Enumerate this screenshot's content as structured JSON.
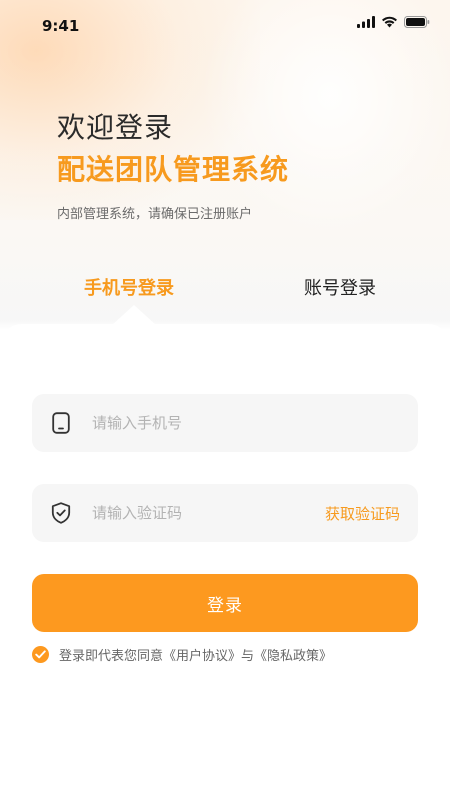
{
  "status_bar": {
    "time": "9:41",
    "icons": [
      "signal-icon",
      "wifi-icon",
      "battery-icon"
    ]
  },
  "header": {
    "welcome": "欢迎登录",
    "system_name": "配送团队管理系统",
    "subtitle": "内部管理系统，请确保已注册账户"
  },
  "tabs": [
    {
      "label": "手机号登录",
      "active": true
    },
    {
      "label": "账号登录",
      "active": false
    }
  ],
  "form": {
    "phone_placeholder": "请输入手机号",
    "phone_value": "",
    "code_placeholder": "请输入验证码",
    "code_value": "",
    "get_code_label": "获取验证码",
    "phone_icon": "phone-icon",
    "code_icon": "shield-check-icon"
  },
  "login_button": {
    "label": "登录"
  },
  "agreement": {
    "checked": true,
    "text": "登录即代表您同意《用户协议》与《隐私政策》"
  },
  "colors": {
    "accent": "#fd991f",
    "accent_text": "#f79a1e",
    "field_bg": "#f6f6f6",
    "title_text": "#2b2b2b"
  }
}
